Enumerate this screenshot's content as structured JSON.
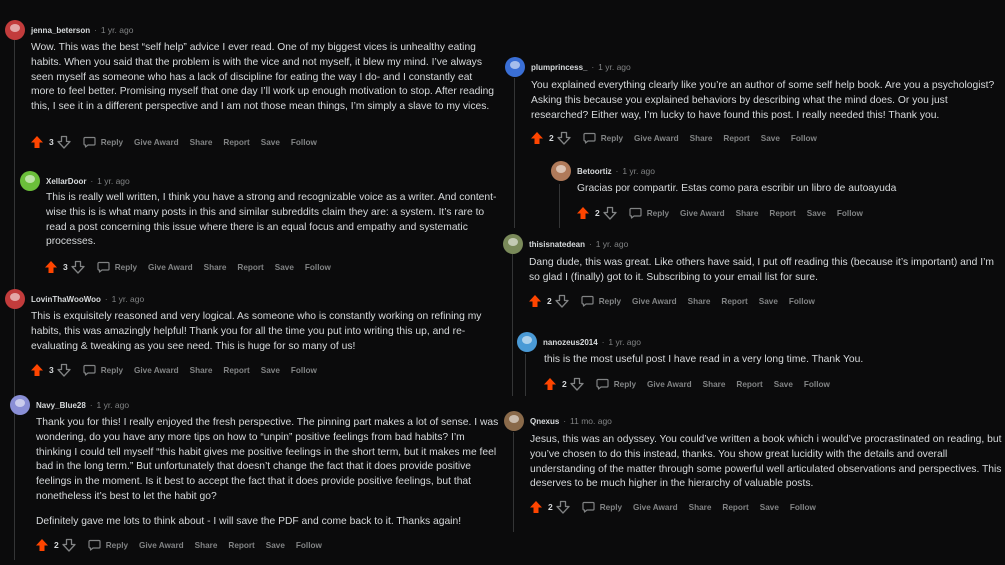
{
  "left": [
    {
      "user": "jenna_beterson",
      "time": "1 yr. ago",
      "avatar_color": "#c23c3c",
      "paragraphs": [
        "Wow. This was the best “self help” advice I ever read. One of my biggest vices is unhealthy eating habits. When you said that the problem is with the vice and not myself, it blew my mind. I’ve always seen myself as someone who has a lack of discipline for eating the way I do- and I constantly eat more to feel better. Promising myself that one day I’ll work up enough motivation to stop. After reading this, I see it in a different perspective and I am not those mean things, I’m simply a slave to my vices."
      ],
      "score": "3",
      "actions": [
        "Reply",
        "Give Award",
        "Share",
        "Report",
        "Save",
        "Follow"
      ]
    },
    {
      "user": "XellarDoor",
      "time": "1 yr. ago",
      "avatar_color": "#6bbf3a",
      "paragraphs": [
        "This is really well written, I think you have a strong and recognizable voice as a writer. And content-wise this is is what many posts in this and similar subreddits claim they are: a system. It’s rare to read a post concerning this issue where there is an equal focus and empathy and systematic processes."
      ],
      "score": "3",
      "actions": [
        "Reply",
        "Give Award",
        "Share",
        "Report",
        "Save",
        "Follow"
      ]
    },
    {
      "user": "LovinThaWooWoo",
      "time": "1 yr. ago",
      "avatar_color": "#c23c3c",
      "paragraphs": [
        "This is exquisitely reasoned and very logical. As someone who is constantly working on refining my habits, this was amazingly helpful! Thank you for all the time you put into writing this up, and re-evaluating & tweaking as you see need. This is huge for so many of us!"
      ],
      "score": "3",
      "actions": [
        "Reply",
        "Give Award",
        "Share",
        "Report",
        "Save",
        "Follow"
      ]
    },
    {
      "user": "Navy_Blue28",
      "time": "1 yr. ago",
      "avatar_color": "#8a8fd6",
      "paragraphs": [
        "Thank you for this! I really enjoyed the fresh perspective. The pinning part makes a lot of sense. I was wondering, do you have any more tips on how to “unpin” positive feelings from bad habits? I’m thinking I could tell myself “this habit gives me positive feelings in the short term, but it makes me feel bad in the long term.” But unfortunately that doesn’t change the fact that it does provide positive feelings in the moment. Is it best to accept the fact that it does provide positive feelings, but that nonetheless it’s best to let the habit go?",
        "Definitely gave me lots to think about - I will save the PDF and come back to it. Thanks again!"
      ],
      "score": "2",
      "actions": [
        "Reply",
        "Give Award",
        "Share",
        "Report",
        "Save",
        "Follow"
      ]
    }
  ],
  "right": [
    {
      "user": "plumprincess_",
      "time": "1 yr. ago",
      "avatar_color": "#3a6fd6",
      "paragraphs": [
        "You explained everything clearly like you’re an author of some self help book. Are you a psychologist? Asking this because you explained behaviors by describing what the mind does. Or you just researched? Either way, I’m lucky to have found this post. I really needed this! Thank you."
      ],
      "score": "2",
      "actions": [
        "Reply",
        "Give Award",
        "Share",
        "Report",
        "Save",
        "Follow"
      ]
    },
    {
      "user": "Betoortiz",
      "time": "1 yr. ago",
      "avatar_color": "#b07a5a",
      "paragraphs": [
        "Gracias por compartir. Estas como para escribir un libro de autoayuda"
      ],
      "score": "2",
      "actions": [
        "Reply",
        "Give Award",
        "Share",
        "Report",
        "Save",
        "Follow"
      ]
    },
    {
      "user": "thisisnatedean",
      "time": "1 yr. ago",
      "avatar_color": "#7a8a5a",
      "paragraphs": [
        "Dang dude, this was great. Like others have said, I put off reading this (because it’s important) and I’m so glad I (finally) got to it. Subscribing to your email list for sure."
      ],
      "score": "2",
      "actions": [
        "Reply",
        "Give Award",
        "Share",
        "Report",
        "Save",
        "Follow"
      ]
    },
    {
      "user": "nanozeus2014",
      "time": "1 yr. ago",
      "avatar_color": "#4a9ad6",
      "paragraphs": [
        "this is the most useful post I have read in a very long time. Thank You."
      ],
      "score": "2",
      "actions": [
        "Reply",
        "Give Award",
        "Share",
        "Report",
        "Save",
        "Follow"
      ]
    },
    {
      "user": "Qnexus",
      "time": "11 mo. ago",
      "avatar_color": "#8a6a4a",
      "paragraphs": [
        "Jesus, this was an odyssey. You could’ve written a book which i would’ve procrastinated on reading, but you’ve chosen to do this instead, thanks. You show great lucidity with the details and overall understanding of the matter through some powerful well articulated observations and perspectives. This deserves to be much higher in the hierarchy of valuable posts."
      ],
      "score": "2",
      "actions": [
        "Reply",
        "Give Award",
        "Share",
        "Report",
        "Save",
        "Follow"
      ]
    }
  ],
  "colors": {
    "upvote": "#ff4500",
    "muted": "#818384",
    "text": "#d7dadc",
    "background": "#0b0b0c"
  },
  "icons": {
    "upvote": "upvote-arrow-icon",
    "downvote": "downvote-arrow-icon",
    "reply": "comment-bubble-icon"
  }
}
